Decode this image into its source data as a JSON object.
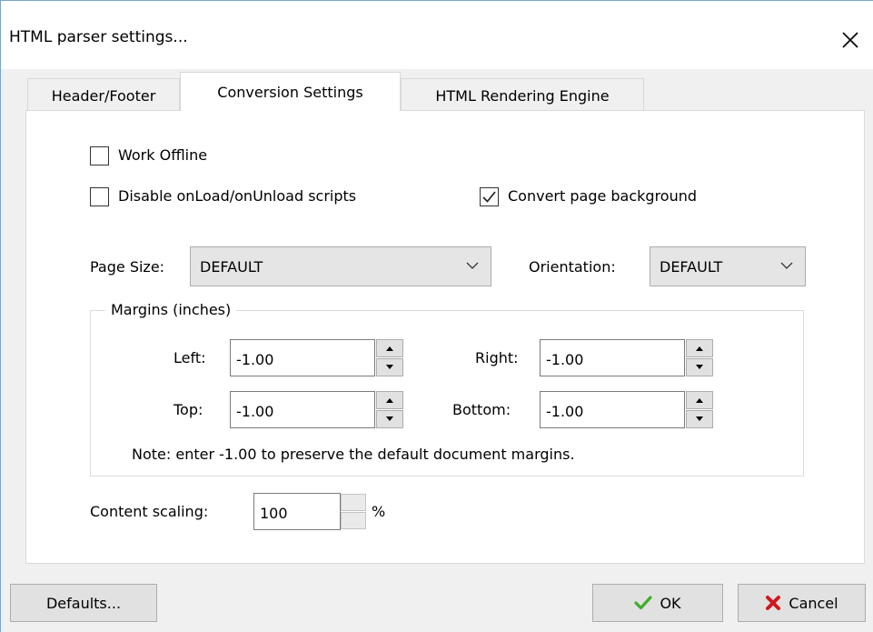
{
  "window": {
    "title": "HTML parser settings..."
  },
  "tabs": [
    {
      "label": "Header/Footer",
      "active": false
    },
    {
      "label": "Conversion Settings",
      "active": true
    },
    {
      "label": "HTML Rendering Engine",
      "active": false
    }
  ],
  "options": {
    "work_offline": {
      "label": "Work Offline",
      "checked": false
    },
    "disable_scripts": {
      "label": "Disable onLoad/onUnload scripts",
      "checked": false
    },
    "convert_background": {
      "label": "Convert page background",
      "checked": true
    }
  },
  "page_size": {
    "label": "Page Size:",
    "value": "DEFAULT"
  },
  "orientation": {
    "label": "Orientation:",
    "value": "DEFAULT"
  },
  "margins": {
    "group_label": "Margins (inches)",
    "left": {
      "label": "Left:",
      "value": "-1.00"
    },
    "right": {
      "label": "Right:",
      "value": "-1.00"
    },
    "top": {
      "label": "Top:",
      "value": "-1.00"
    },
    "bottom": {
      "label": "Bottom:",
      "value": "-1.00"
    },
    "note": "Note: enter -1.00 to preserve the default document margins."
  },
  "content_scaling": {
    "label": "Content scaling:",
    "value": "100",
    "unit": "%"
  },
  "buttons": {
    "defaults": "Defaults...",
    "ok": "OK",
    "cancel": "Cancel"
  },
  "colors": {
    "ok_check": "#3fae29",
    "cancel_x": "#d0181f",
    "window_border": "#7aa6c9"
  }
}
